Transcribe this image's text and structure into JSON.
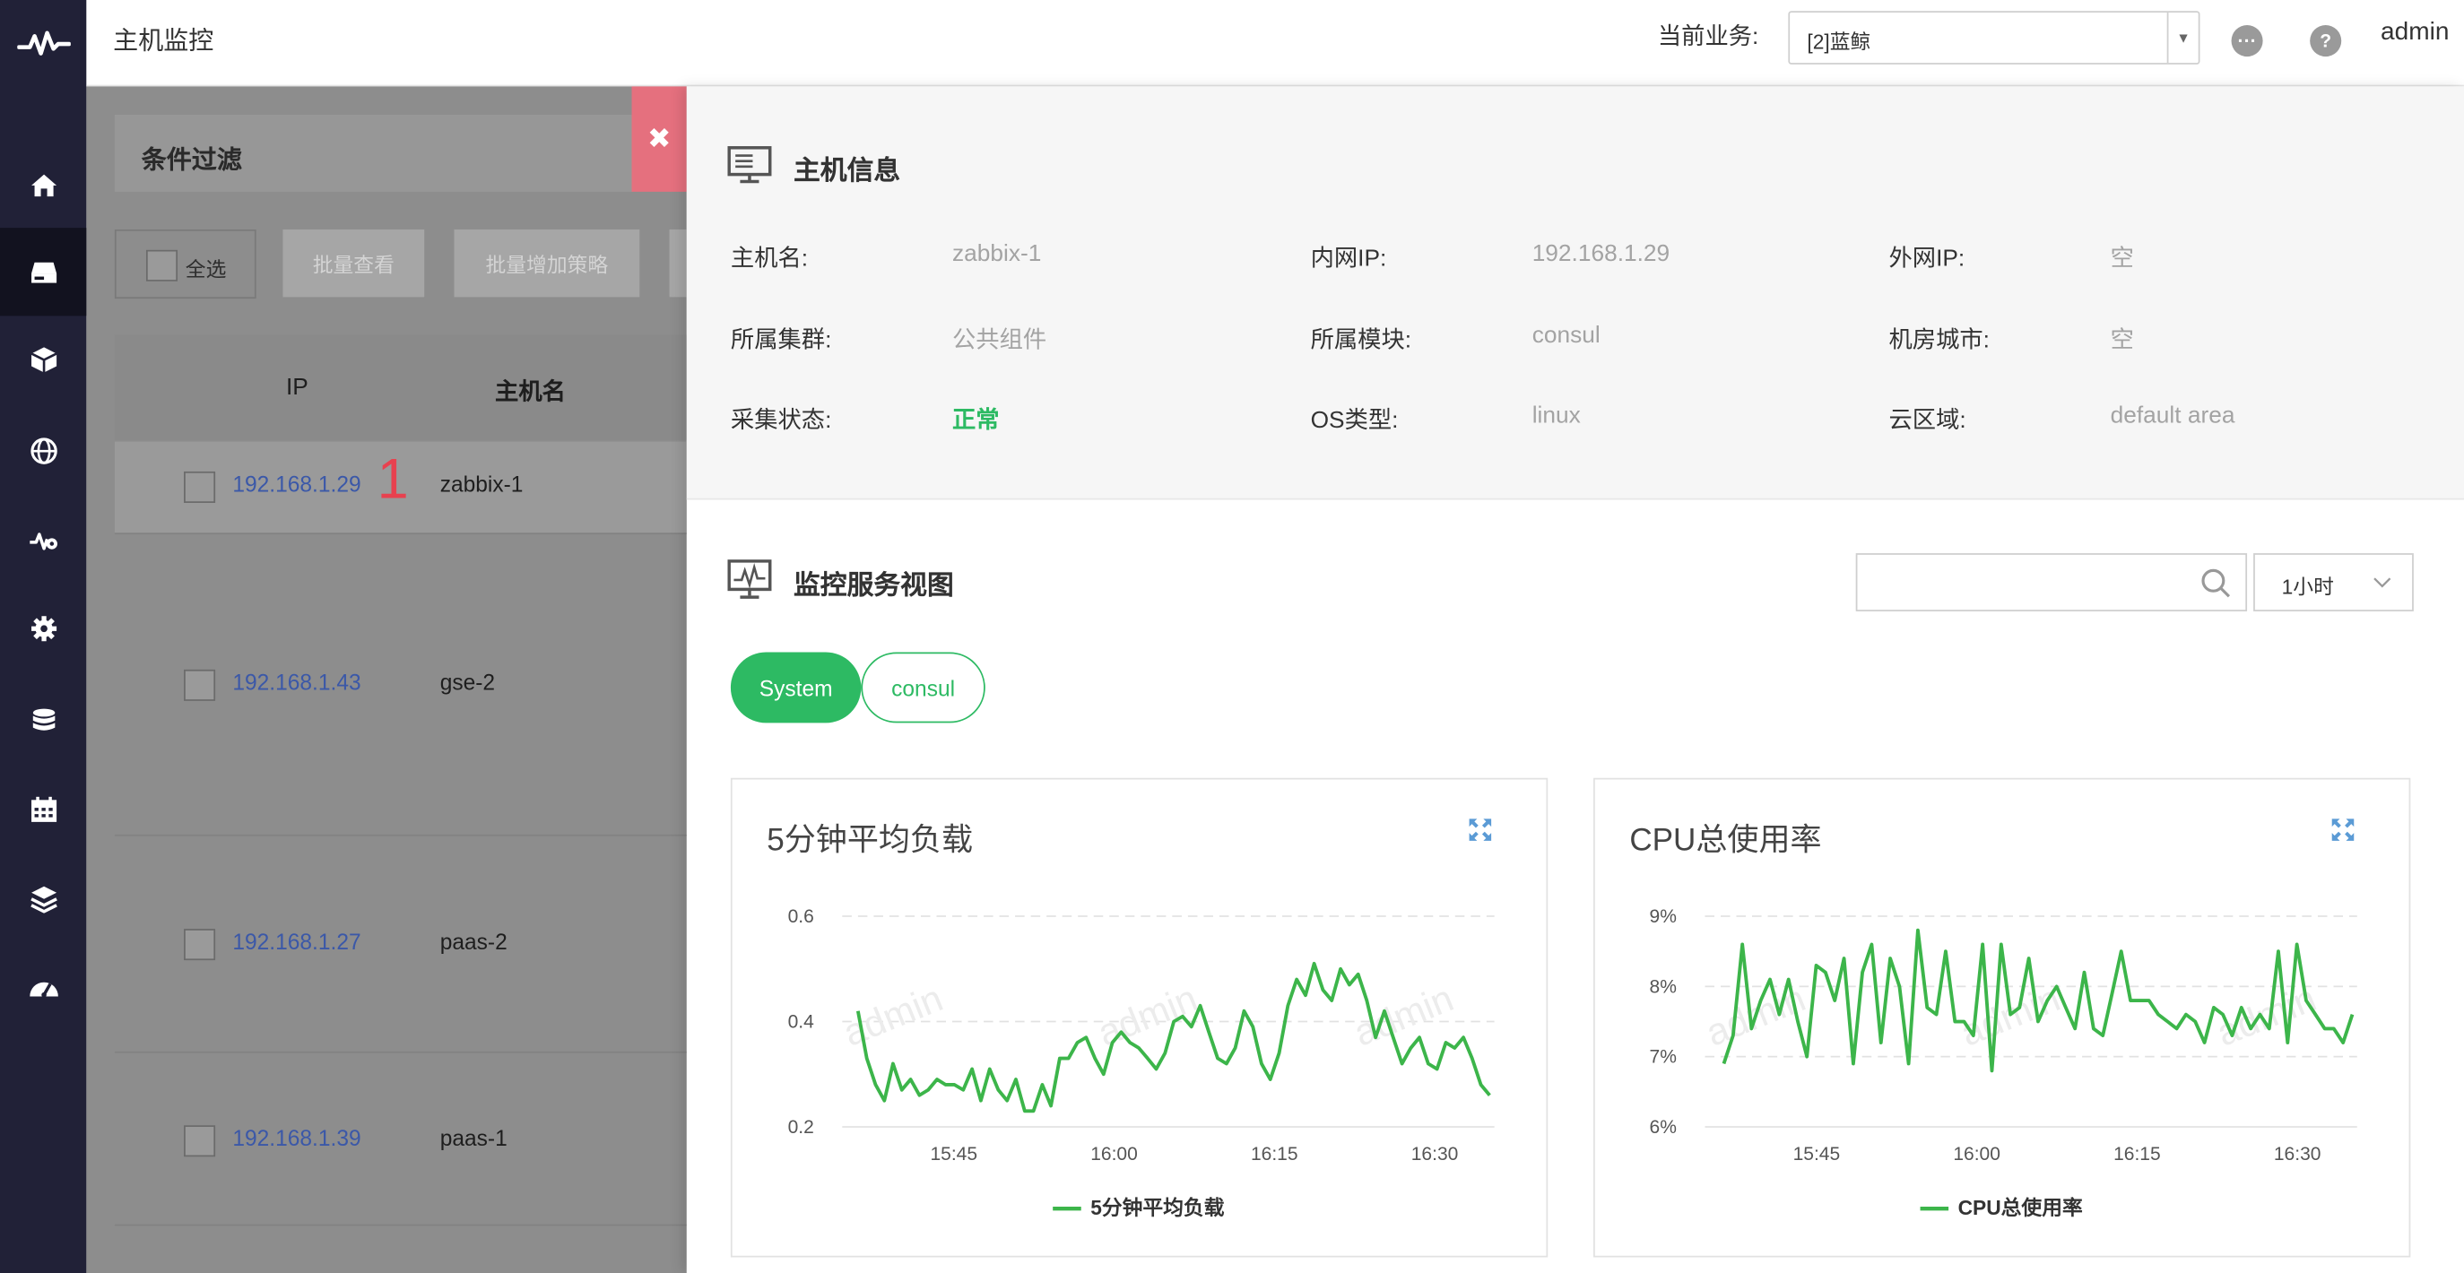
{
  "header": {
    "title": "主机监控",
    "business_label": "当前业务:",
    "business_value": "[2]蓝鲸",
    "more_icon": "more-icon",
    "help_icon": "help-icon",
    "user": "admin"
  },
  "sidebar": {
    "logo": "pulse-logo-icon",
    "items": [
      {
        "icon": "home-icon",
        "active": false
      },
      {
        "icon": "host-icon",
        "active": true
      },
      {
        "icon": "box-icon",
        "active": false
      },
      {
        "icon": "globe-icon",
        "active": false
      },
      {
        "icon": "pulse-gear-icon",
        "active": false
      },
      {
        "icon": "settings-icon",
        "active": false
      },
      {
        "icon": "database-icon",
        "active": false
      },
      {
        "icon": "calendar-icon",
        "active": false
      },
      {
        "icon": "layers-icon",
        "active": false
      },
      {
        "icon": "dashboard-icon",
        "active": false
      }
    ]
  },
  "left": {
    "filter_title": "条件过滤",
    "select_all": "全选",
    "batch_view": "批量查看",
    "batch_add_policy": "批量增加策略",
    "columns": {
      "ip": "IP",
      "host": "主机名"
    },
    "marker": "1",
    "rows": [
      {
        "ip": "192.168.1.29",
        "host": "zabbix-1"
      },
      {
        "ip": "192.168.1.43",
        "host": "gse-2"
      },
      {
        "ip": "192.168.1.27",
        "host": "paas-2"
      },
      {
        "ip": "192.168.1.39",
        "host": "paas-1"
      }
    ]
  },
  "panel": {
    "info_title": "主机信息",
    "info": [
      {
        "label": "主机名:",
        "value": "zabbix-1"
      },
      {
        "label": "内网IP:",
        "value": "192.168.1.29"
      },
      {
        "label": "外网IP:",
        "value": "空"
      },
      {
        "label": "所属集群:",
        "value": "公共组件"
      },
      {
        "label": "所属模块:",
        "value": "consul"
      },
      {
        "label": "机房城市:",
        "value": "空"
      },
      {
        "label": "采集状态:",
        "value": "正常"
      },
      {
        "label": "OS类型:",
        "value": "linux"
      },
      {
        "label": "云区域:",
        "value": "default area"
      }
    ],
    "monitor_title": "监控服务视图",
    "search_placeholder": "",
    "range_value": "1小时",
    "tabs": [
      {
        "label": "System",
        "active": true
      },
      {
        "label": "consul",
        "active": false
      }
    ],
    "watermark": "admin"
  },
  "chart_data": [
    {
      "type": "line",
      "title": "5分钟平均负载",
      "x_ticks": [
        "15:45",
        "16:00",
        "16:15",
        "16:30"
      ],
      "y_ticks": [
        "0.6",
        "0.4",
        "0.2"
      ],
      "ylim": [
        0.2,
        0.6
      ],
      "legend": "5分钟平均负载",
      "color": "#3cb54a",
      "values": [
        0.42,
        0.33,
        0.28,
        0.25,
        0.32,
        0.27,
        0.29,
        0.26,
        0.27,
        0.29,
        0.28,
        0.28,
        0.27,
        0.31,
        0.25,
        0.31,
        0.27,
        0.25,
        0.29,
        0.23,
        0.23,
        0.28,
        0.24,
        0.33,
        0.33,
        0.36,
        0.37,
        0.33,
        0.3,
        0.36,
        0.38,
        0.36,
        0.35,
        0.33,
        0.31,
        0.34,
        0.4,
        0.41,
        0.39,
        0.43,
        0.38,
        0.33,
        0.32,
        0.35,
        0.42,
        0.39,
        0.32,
        0.29,
        0.34,
        0.43,
        0.48,
        0.45,
        0.51,
        0.46,
        0.44,
        0.5,
        0.47,
        0.49,
        0.44,
        0.37,
        0.42,
        0.37,
        0.32,
        0.35,
        0.37,
        0.32,
        0.31,
        0.36,
        0.35,
        0.37,
        0.33,
        0.28,
        0.26
      ]
    },
    {
      "type": "line",
      "title": "CPU总使用率",
      "x_ticks": [
        "15:45",
        "16:00",
        "16:15",
        "16:30"
      ],
      "y_ticks": [
        "9%",
        "8%",
        "7%",
        "6%"
      ],
      "ylim": [
        6,
        9
      ],
      "legend": "CPU总使用率",
      "color": "#3cb54a",
      "values": [
        6.9,
        7.3,
        8.6,
        7.4,
        7.8,
        8.1,
        7.6,
        8.1,
        7.5,
        7.0,
        8.3,
        8.2,
        7.8,
        8.4,
        6.9,
        8.2,
        8.6,
        7.2,
        8.4,
        8.0,
        6.9,
        8.8,
        7.7,
        7.6,
        8.5,
        7.5,
        7.5,
        7.3,
        8.6,
        6.8,
        8.6,
        7.6,
        7.7,
        8.4,
        7.5,
        7.8,
        8.0,
        7.7,
        7.4,
        8.2,
        7.4,
        7.3,
        7.9,
        8.5,
        7.8,
        7.8,
        7.8,
        7.6,
        7.5,
        7.4,
        7.6,
        7.5,
        7.2,
        7.7,
        7.6,
        7.3,
        7.7,
        7.4,
        7.6,
        7.4,
        8.5,
        7.2,
        8.6,
        7.8,
        7.6,
        7.4,
        7.4,
        7.2,
        7.6
      ]
    }
  ]
}
